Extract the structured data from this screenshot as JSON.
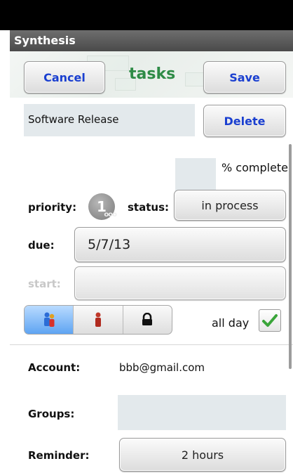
{
  "titlebar": {
    "title": "Synthesis"
  },
  "header": {
    "cancel_label": "Cancel",
    "app_title": "tasks",
    "save_label": "Save"
  },
  "task": {
    "name": "Software Release",
    "delete_label": "Delete"
  },
  "progress": {
    "percent_value": "",
    "percent_label": "% complete"
  },
  "priority": {
    "label": "priority:",
    "value": "1"
  },
  "status": {
    "label": "status:",
    "value": "in process"
  },
  "due": {
    "label": "due:",
    "value": "5/7/13"
  },
  "start": {
    "label": "start:",
    "value": ""
  },
  "segments": [
    {
      "icon": "people-icon",
      "active": true
    },
    {
      "icon": "person-icon",
      "active": false
    },
    {
      "icon": "lock-icon",
      "active": false
    }
  ],
  "all_day": {
    "label": "all day",
    "checked": true
  },
  "account": {
    "label": "Account:",
    "value": "bbb@gmail.com"
  },
  "groups": {
    "label": "Groups:",
    "value": ""
  },
  "reminder": {
    "label": "Reminder:",
    "value": "2 hours"
  },
  "colors": {
    "accent_green": "#2e8b46",
    "button_blue": "#1a3fd0",
    "field_bg": "#e3e9ec",
    "segment_active": "#5ea4f2"
  }
}
